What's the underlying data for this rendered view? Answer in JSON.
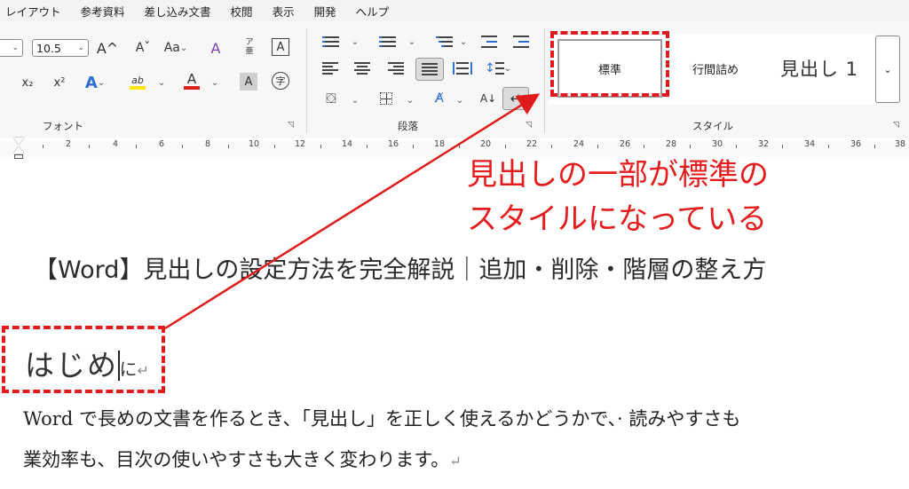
{
  "menu": {
    "items": [
      "レイアウト",
      "参考資料",
      "差し込み文書",
      "校閲",
      "表示",
      "開発",
      "ヘルプ"
    ]
  },
  "font_group": {
    "font_size": "10.5",
    "grow_label": "A^",
    "shrink_label": "Aˇ",
    "case_label": "Aa",
    "clear_label": "A",
    "ruby_top": "ア",
    "ruby_bottom": "亜",
    "border_label": "A",
    "subscript_label": "x₂",
    "superscript_label": "x²",
    "effect_label": "A",
    "highlight_label": "ab",
    "color_label": "A",
    "shading_label": "A",
    "enclose_label": "字",
    "label": "フォント"
  },
  "paragraph_group": {
    "sort_label": "A↓",
    "label": "段落"
  },
  "styles_group": {
    "items": [
      "標準",
      "行間詰め",
      "見出し 1"
    ],
    "label": "スタイル"
  },
  "ruler": {
    "numbers": [
      "2",
      "4",
      "6",
      "8",
      "10",
      "12",
      "14",
      "16",
      "18",
      "20",
      "22",
      "24",
      "26",
      "28",
      "30",
      "32",
      "34",
      "36",
      "38"
    ]
  },
  "document": {
    "title": "【Word】見出しの設定方法を完全解説｜追加・削除・階層の整え方",
    "heading_big": "はじめ",
    "heading_small": "に",
    "pilcrow": "↵",
    "body_line1": "Word で長めの文書を作るとき、「見出し」を正しく使えるかどうかで、· 読みやすさも",
    "body_line2": "業効率も、目次の使いやすさも大きく変わります。"
  },
  "annotation": {
    "line1": "見出しの一部が標準の",
    "line2": "スタイルになっている",
    "color": "#e41c1c"
  }
}
